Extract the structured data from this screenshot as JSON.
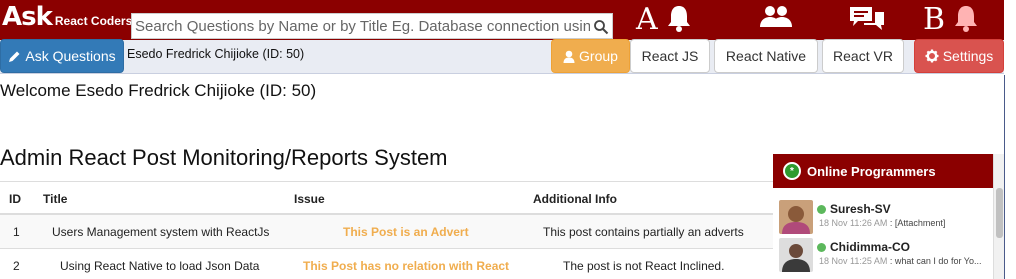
{
  "brand": {
    "main": "Ask",
    "sub": "React Coders"
  },
  "search": {
    "placeholder": "Search Questions by Name or by Title Eg. Database connection using React"
  },
  "markers": {
    "a": "A",
    "b": "B"
  },
  "icons": {
    "notifications": "bell-icon",
    "group": "group-icon",
    "chat": "chat-icon",
    "alerts": "bell-icon",
    "search": "search-icon"
  },
  "toolbar": {
    "ask_label": "Ask Questions",
    "user": "Esedo Fredrick Chijioke (ID: 50)",
    "group_label": "Group",
    "react_js_label": "React JS",
    "react_native_label": "React Native",
    "react_vr_label": "React VR",
    "settings_label": "Settings"
  },
  "welcome": "Welcome Esedo Fredrick Chijioke (ID: 50)",
  "page_title": "Admin React Post Monitoring/Reports System",
  "table": {
    "headers": [
      "ID",
      "Title",
      "Issue",
      "Additional Info"
    ],
    "rows": [
      {
        "id": "1",
        "title": "Users Management system with ReactJs",
        "issue": "This Post is an Advert",
        "info": "This post contains partially an adverts"
      },
      {
        "id": "2",
        "title": "Using React Native to load Json Data",
        "issue": "This Post has no relation with React",
        "info": "The post is not React Inclined."
      }
    ]
  },
  "online": {
    "title": "Online Programmers",
    "badge": "*",
    "programmers": [
      {
        "name": "Suresh-SV",
        "time": "18 Nov 11:26 AM",
        "message": "[Attachment]"
      },
      {
        "name": "Chidimma-CO",
        "time": "18 Nov 11:25 AM",
        "message": "what can I do for Yo..."
      }
    ]
  },
  "colors": {
    "topbar": "#8b0000",
    "primary": "#337ab7",
    "warning": "#f0ad4e",
    "danger": "#d9534f",
    "online": "#5cb85c"
  }
}
